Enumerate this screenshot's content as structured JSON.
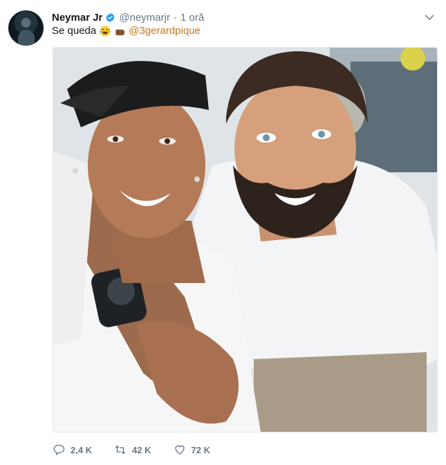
{
  "tweet": {
    "author_name": "Neymar Jr",
    "author_handle": "@neymarjr",
    "separator": "·",
    "time_ago": "1 oră",
    "text": "Se queda",
    "mention": "@3gerardpique",
    "emojis": [
      "tears-of-joy-emoji",
      "fist-bump-emoji"
    ],
    "verified": true
  },
  "actions": {
    "replies": "2,4 K",
    "retweets": "42 K",
    "likes": "72 K"
  },
  "colors": {
    "mention": "#c77718",
    "secondary_text": "#657786",
    "verified_badge": "#1da1f2"
  }
}
